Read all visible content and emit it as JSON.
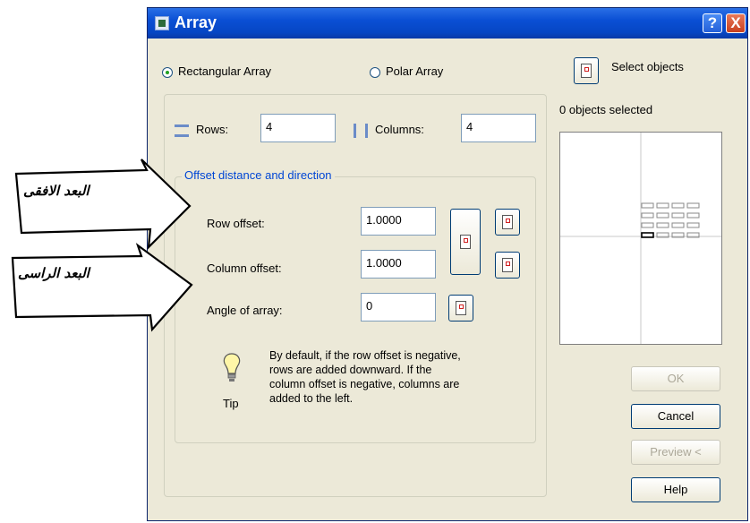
{
  "window": {
    "title": "Array",
    "help_label": "?",
    "close_label": "X"
  },
  "mode": {
    "rectangular_label": "Rectangular Array",
    "polar_label": "Polar Array",
    "selected": "rectangular"
  },
  "select": {
    "button_label": "Select objects",
    "status": "0 objects selected"
  },
  "grid": {
    "rows_label": "Rows:",
    "rows_value": "4",
    "columns_label": "Columns:",
    "columns_value": "4"
  },
  "offset": {
    "group_title": "Offset distance and direction",
    "row_offset_label": "Row offset:",
    "row_offset_value": "1.0000",
    "column_offset_label": "Column offset:",
    "column_offset_value": "1.0000",
    "angle_label": "Angle of array:",
    "angle_value": "0"
  },
  "tip": {
    "label": "Tip",
    "text_lines": [
      "By default, if the row offset is negative,",
      "rows are added downward.  If the",
      "column offset is negative, columns are",
      "added to the left."
    ]
  },
  "buttons": {
    "ok": "OK",
    "cancel": "Cancel",
    "preview": "Preview <",
    "help": "Help"
  },
  "preview": {
    "rows": 4,
    "columns": 4
  },
  "annotations": {
    "horizontal": "البعد الافقى",
    "vertical": "البعد الراسى"
  },
  "colors": {
    "title_bar": "#0a4fd4",
    "dialog_bg": "#ece9d8",
    "group_title": "#0046d5",
    "arrow_fill": "#ffffff"
  }
}
